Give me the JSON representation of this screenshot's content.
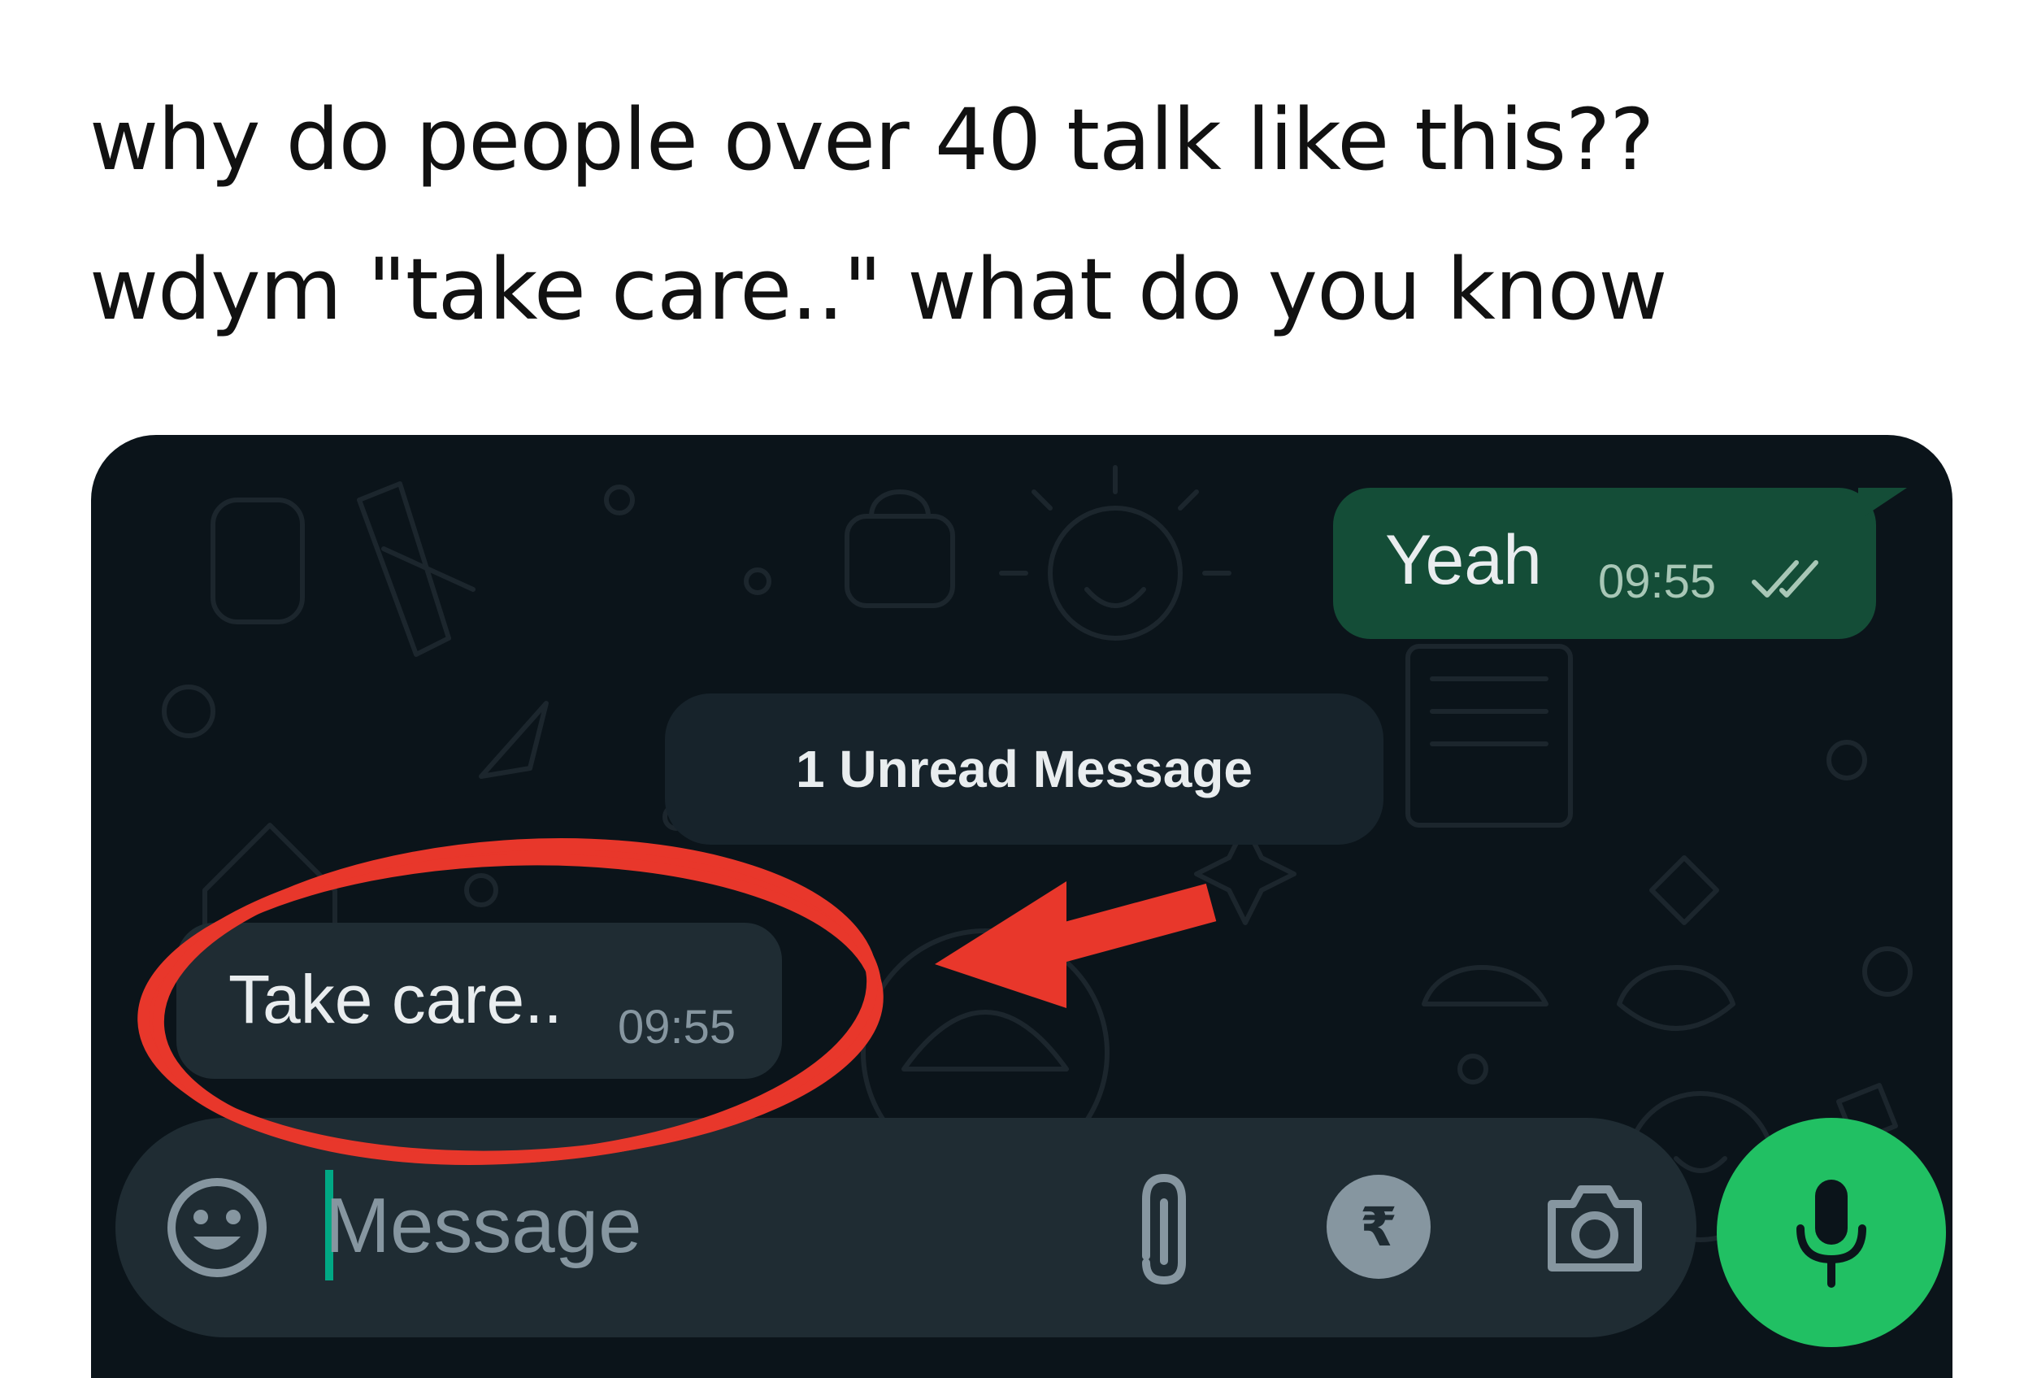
{
  "caption": {
    "line1": "why do people over 40 talk like this??",
    "line2": "wdym \"take care..\" what do you know"
  },
  "chat": {
    "outgoing": {
      "text": "Yeah",
      "time": "09:55",
      "status_icon": "double-check-icon"
    },
    "unread_banner": "1 Unread Message",
    "incoming": {
      "text": "Take care..",
      "time": "09:55"
    }
  },
  "input_bar": {
    "placeholder": "Message",
    "icons": [
      "emoji-icon",
      "paperclip-icon",
      "rupee-icon",
      "camera-icon",
      "microphone-icon"
    ],
    "pay_symbol": "₹"
  },
  "colors": {
    "chat_background": "#0b141a",
    "outgoing_bubble": "#144d37",
    "incoming_bubble": "#1f2c33",
    "mic_button": "#21c063",
    "annotation": "#e8372b"
  }
}
